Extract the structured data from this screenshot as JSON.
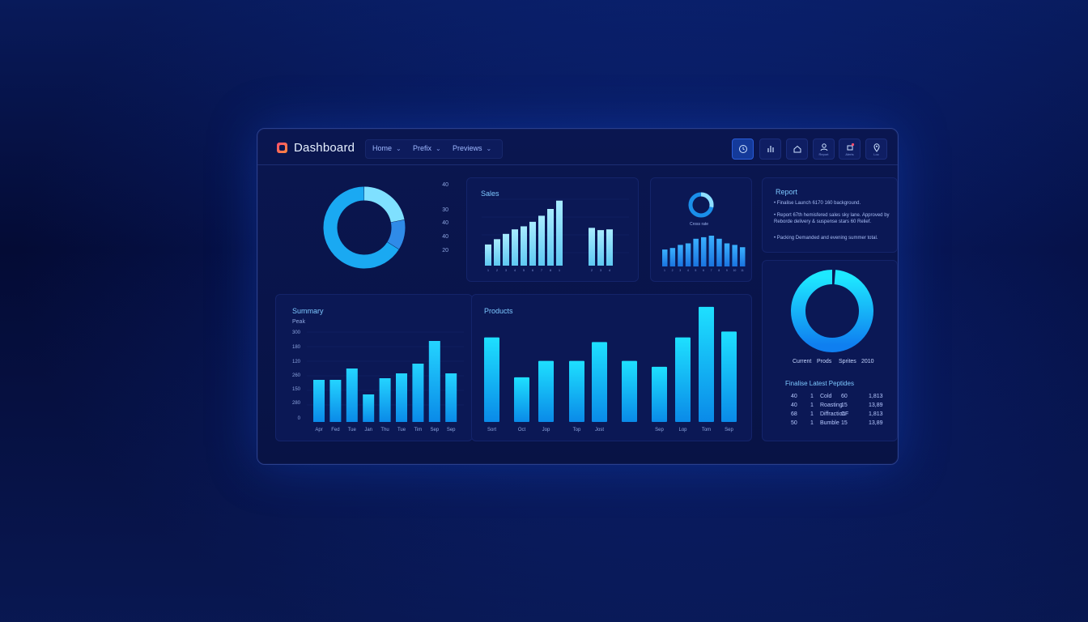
{
  "header": {
    "app_title": "Dashboard",
    "nav": [
      {
        "label": "Home"
      },
      {
        "label": "Prefix"
      },
      {
        "label": "Previews"
      }
    ],
    "icons": [
      {
        "name": "clock-icon",
        "caption": ""
      },
      {
        "name": "bar-chart-icon",
        "caption": ""
      },
      {
        "name": "home-icon",
        "caption": ""
      },
      {
        "name": "user-icon",
        "caption": "Report"
      },
      {
        "name": "notification-icon",
        "caption": "Alerts"
      },
      {
        "name": "location-pin-icon",
        "caption": "Loc"
      }
    ],
    "accent": "#1fb6ff"
  },
  "donut_card": {
    "y_labels": [
      "40",
      "30",
      "40",
      "40",
      "20"
    ],
    "segments": [
      {
        "value": 0.22,
        "color": "#7fe0ff"
      },
      {
        "value": 0.12,
        "color": "#2f8be8"
      },
      {
        "value": 0.66,
        "color": "#1aa9f2"
      }
    ]
  },
  "sales_card": {
    "title": "Sales",
    "values": [
      28,
      35,
      42,
      48,
      52,
      58,
      66,
      75,
      86,
      50,
      47,
      48
    ],
    "x_labels": [
      "1",
      "2",
      "3",
      "4",
      "5",
      "6",
      "7",
      "8",
      "1",
      "2",
      "3",
      "4"
    ],
    "y_labels": [
      "",
      "",
      "",
      "",
      ""
    ]
  },
  "mini_card": {
    "caption": "Cross rate",
    "values": [
      22,
      24,
      28,
      30,
      36,
      38,
      40,
      36,
      30,
      28,
      25
    ],
    "x_labels": [
      "1",
      "2",
      "3",
      "4",
      "5",
      "6",
      "7",
      "8",
      "9",
      "10",
      "11"
    ]
  },
  "report_card": {
    "title": "Report",
    "bullets": [
      "Finalise Launch 6170 160 background.",
      "Report 67th hemisfered sales sky lane. Approved by Reborde delivery & suspense stars 60 Relief.",
      "Packing Demanded and evening summer total."
    ]
  },
  "summary_card": {
    "title": "Summary",
    "sub": "Peak",
    "y_labels": [
      "300",
      "180",
      "120",
      "260",
      "150",
      "280",
      "0"
    ],
    "values": [
      26,
      26,
      33,
      17,
      27,
      30,
      36,
      50,
      30
    ],
    "x_labels": [
      "Apr",
      "Fed",
      "Tue",
      "Jan",
      "Thu",
      "Tue",
      "Tim",
      "Sep",
      "Sep"
    ]
  },
  "products_card": {
    "title": "Products",
    "values": [
      72,
      38,
      52,
      52,
      68,
      52,
      47,
      72,
      98,
      77
    ],
    "x_labels": [
      "Sort",
      "Oct",
      "Jop",
      "Top",
      "Jost",
      "",
      "Sep",
      "Lop",
      "Tom",
      "Sep"
    ]
  },
  "ring_card": {
    "legend": [
      "Current",
      "Prods",
      "Sprites",
      "2010"
    ],
    "table_title": "Finalise Latest Peptides",
    "rows": [
      [
        "40",
        "1",
        "Cold",
        "60",
        "1,813"
      ],
      [
        "40",
        "1",
        "Roasting",
        "15",
        "13,89"
      ],
      [
        "68",
        "1",
        "Diffraction",
        "CF",
        "1,813"
      ],
      [
        "50",
        "1",
        "Bumble",
        "15",
        "13,89"
      ]
    ]
  }
}
